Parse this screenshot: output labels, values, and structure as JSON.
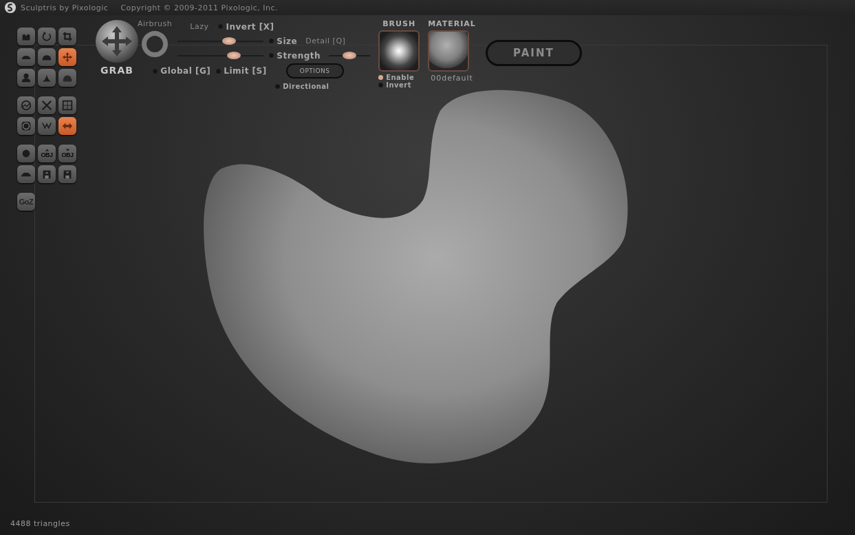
{
  "title_bar": {
    "app": "Sculptris by Pixologic",
    "copyright": "Copyright © 2009-2011 Pixologic, Inc."
  },
  "tool_groups": [
    {
      "tools": [
        {
          "kind": "crease",
          "selected": false
        },
        {
          "kind": "rotate",
          "selected": false
        },
        {
          "kind": "crop",
          "selected": false
        },
        {
          "kind": "flatten",
          "selected": false
        },
        {
          "kind": "inflate",
          "selected": false
        },
        {
          "kind": "grab",
          "selected": true
        },
        {
          "kind": "draw",
          "selected": false
        },
        {
          "kind": "pinch",
          "selected": false
        },
        {
          "kind": "smooth",
          "selected": false
        }
      ]
    },
    {
      "tools": [
        {
          "kind": "sphere-wave",
          "selected": false
        },
        {
          "kind": "cross",
          "selected": false
        },
        {
          "kind": "grid",
          "selected": false
        },
        {
          "kind": "mask",
          "selected": false
        },
        {
          "kind": "reduce",
          "selected": false
        },
        {
          "kind": "symmetry",
          "selected": true
        }
      ]
    },
    {
      "tools": [
        {
          "kind": "ball",
          "selected": false
        },
        {
          "kind": "import",
          "label": "OBJ",
          "selected": false
        },
        {
          "kind": "export",
          "label": "OBJ",
          "selected": false
        },
        {
          "kind": "plane",
          "selected": false
        },
        {
          "kind": "open",
          "selected": false
        },
        {
          "kind": "save",
          "selected": false
        }
      ]
    },
    {
      "tools": [
        {
          "kind": "text",
          "label": "GoZ",
          "selected": false
        }
      ]
    }
  ],
  "brush_tool": {
    "name": "GRAB"
  },
  "labels": {
    "airbrush": "Airbrush",
    "lazy": "Lazy",
    "detail": "Detail [Q]"
  },
  "invert": {
    "label": "Invert [X]",
    "on": false
  },
  "size": {
    "label": "Size",
    "on": false,
    "level": 0.6
  },
  "strength": {
    "label": "Strength",
    "on": false,
    "level": 0.65
  },
  "detail_slider": {
    "level": 0.5
  },
  "global": {
    "label": "Global [G]",
    "on": false
  },
  "limit": {
    "label": "Limit [S]",
    "on": false
  },
  "options_button": "OPTIONS",
  "directional": {
    "label": "Directional",
    "on": false
  },
  "brush": {
    "title": "BRUSH",
    "enable": {
      "label": "Enable",
      "on": true
    },
    "invert": {
      "label": "Invert",
      "on": false
    }
  },
  "material": {
    "title": "MATERIAL",
    "name": "00default"
  },
  "paint_button": "PAINT",
  "status_bar": "4488 triangles"
}
